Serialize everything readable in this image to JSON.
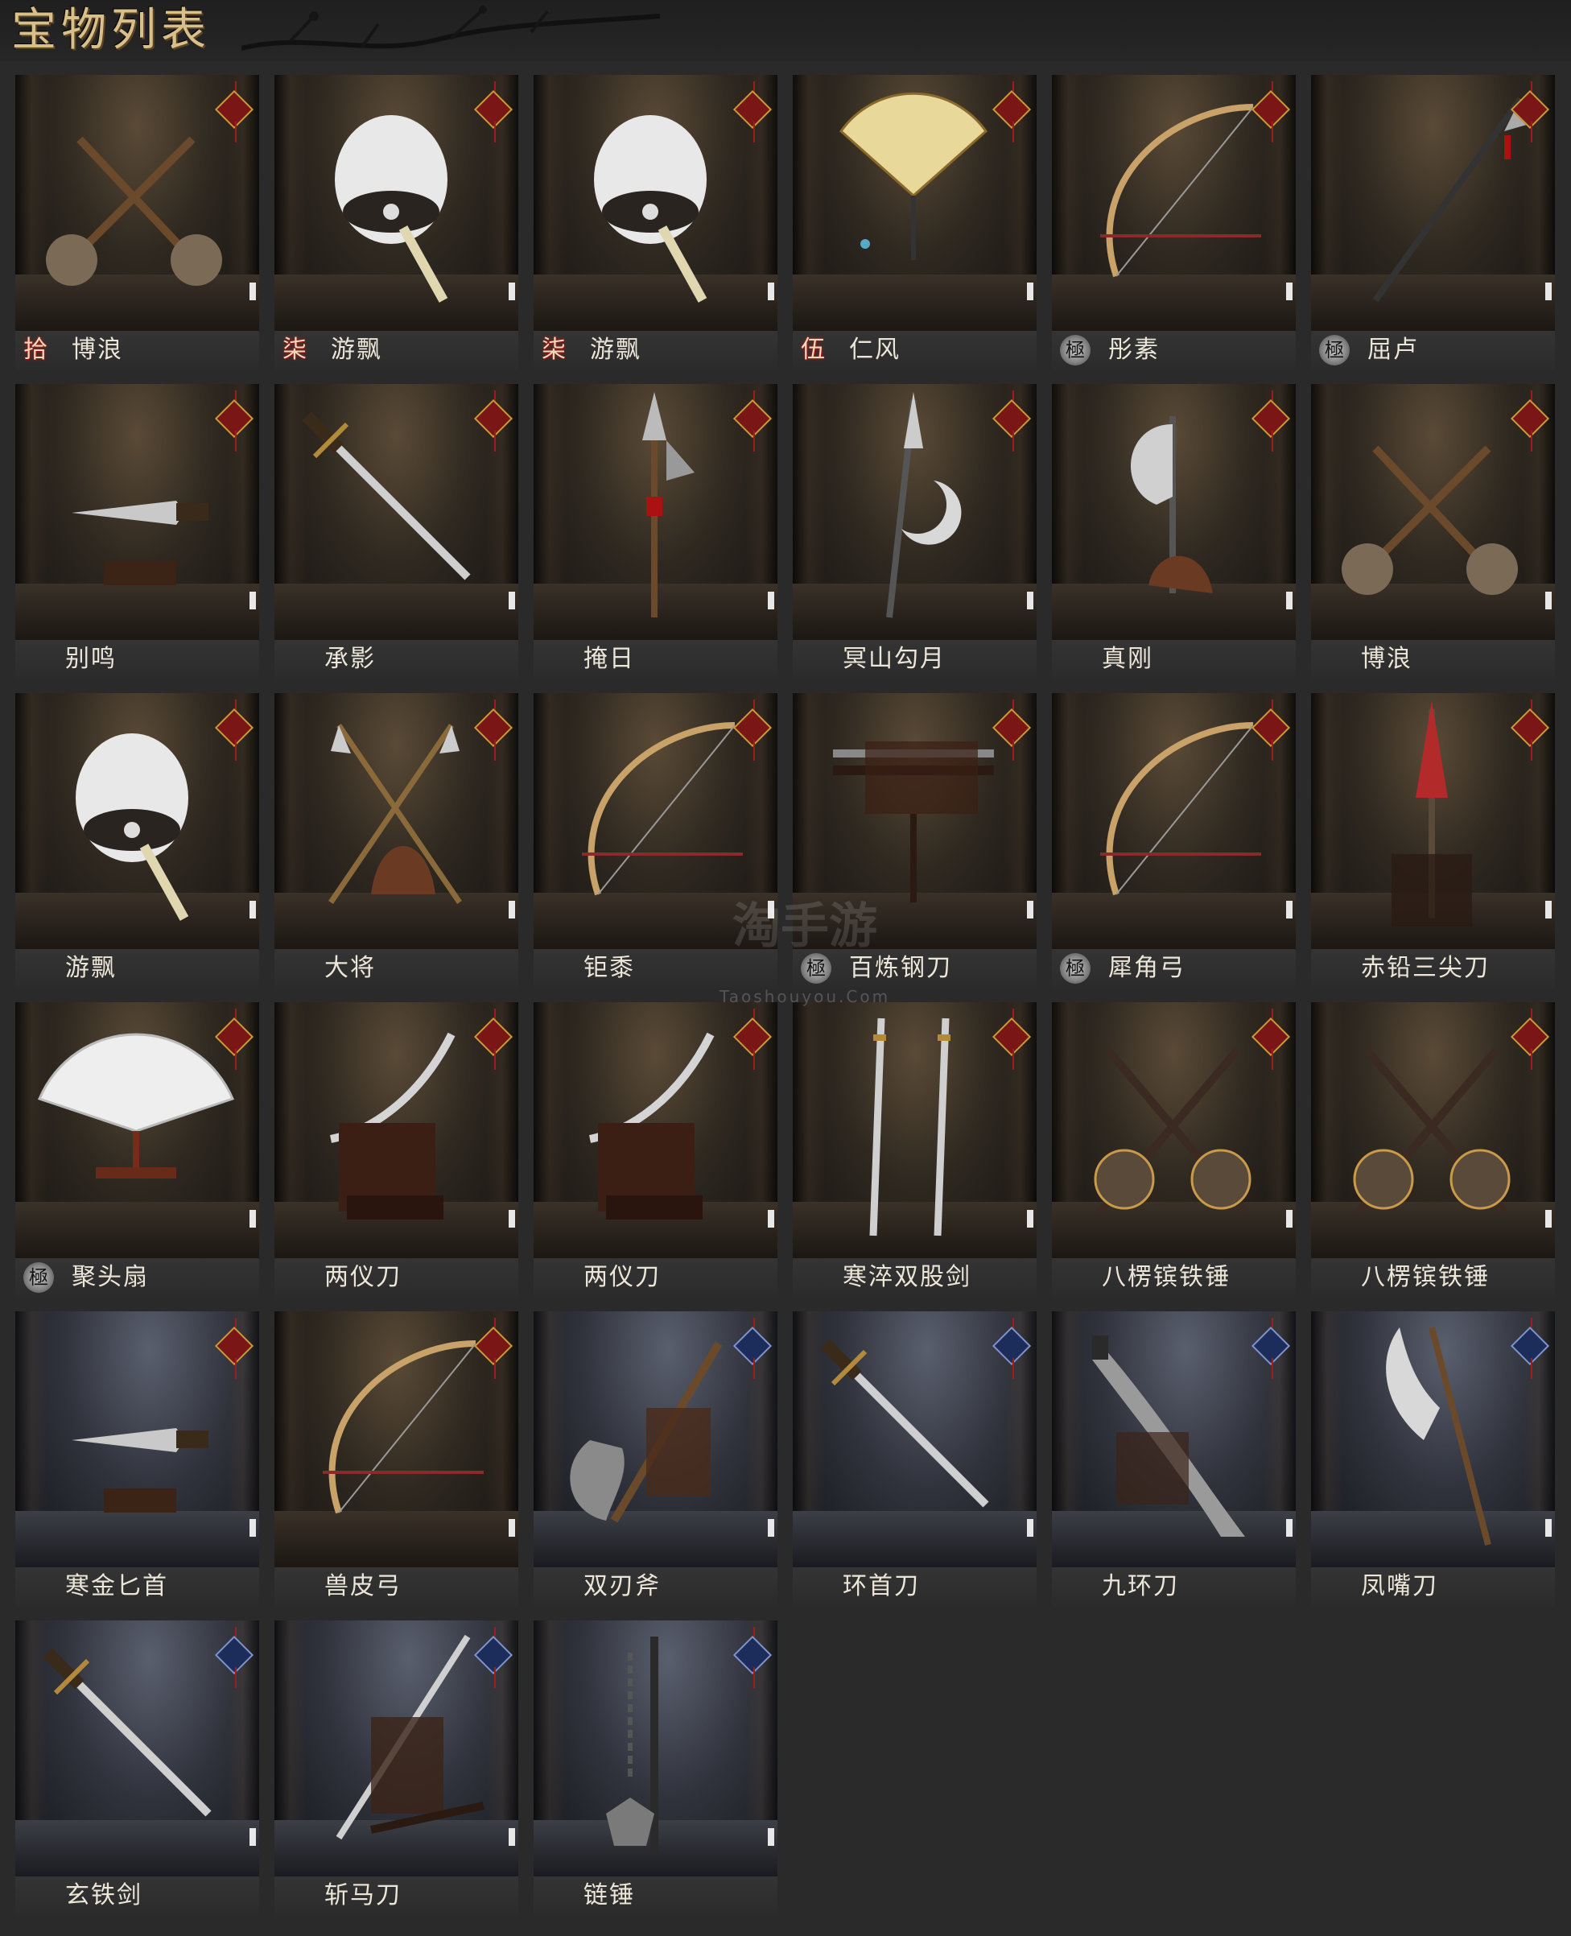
{
  "header": {
    "title": "宝物列表"
  },
  "watermark": {
    "main": "淘手游",
    "sub": "Taoshouyou.Com"
  },
  "colors": {
    "tag_red": "#7a1616",
    "tag_blue": "#1c2d5c",
    "name_text": "#ece6d8",
    "title_gold": "#d9c08a"
  },
  "items": [
    {
      "name": "博浪",
      "rank": "拾",
      "rank_style": "red",
      "weapon": "crossed-hammers",
      "tone": "warm",
      "tag": "red"
    },
    {
      "name": "游飘",
      "rank": "柒",
      "rank_style": "red",
      "weapon": "feather-fan",
      "tone": "warm",
      "tag": "red"
    },
    {
      "name": "游飘",
      "rank": "柒",
      "rank_style": "red",
      "weapon": "feather-fan",
      "tone": "warm",
      "tag": "red"
    },
    {
      "name": "仁风",
      "rank": "伍",
      "rank_style": "red",
      "weapon": "folding-fan",
      "tone": "warm",
      "tag": "red"
    },
    {
      "name": "彤素",
      "rank": "極",
      "rank_style": "gray",
      "weapon": "bow",
      "tone": "warm",
      "tag": "red"
    },
    {
      "name": "屈卢",
      "rank": "極",
      "rank_style": "gray",
      "weapon": "spear",
      "tone": "warm",
      "tag": "red"
    },
    {
      "name": "别鸣",
      "rank": "",
      "rank_style": "",
      "weapon": "dagger",
      "tone": "warm",
      "tag": "red"
    },
    {
      "name": "承影",
      "rank": "",
      "rank_style": "",
      "weapon": "sword",
      "tone": "warm",
      "tag": "red"
    },
    {
      "name": "掩日",
      "rank": "",
      "rank_style": "",
      "weapon": "halberd",
      "tone": "warm",
      "tag": "red"
    },
    {
      "name": "冥山勾月",
      "rank": "",
      "rank_style": "",
      "weapon": "moon-halberd",
      "tone": "warm",
      "tag": "red"
    },
    {
      "name": "真刚",
      "rank": "",
      "rank_style": "",
      "weapon": "axe",
      "tone": "warm",
      "tag": "red"
    },
    {
      "name": "博浪",
      "rank": "",
      "rank_style": "",
      "weapon": "crossed-hammers",
      "tone": "warm",
      "tag": "red"
    },
    {
      "name": "游飘",
      "rank": "",
      "rank_style": "",
      "weapon": "feather-fan",
      "tone": "warm",
      "tag": "red"
    },
    {
      "name": "大将",
      "rank": "",
      "rank_style": "",
      "weapon": "crossed-spears",
      "tone": "warm",
      "tag": "red"
    },
    {
      "name": "钜黍",
      "rank": "",
      "rank_style": "",
      "weapon": "bow",
      "tone": "warm",
      "tag": "red"
    },
    {
      "name": "百炼钢刀",
      "rank": "極",
      "rank_style": "gray",
      "weapon": "sheathed-sword",
      "tone": "warm",
      "tag": "red"
    },
    {
      "name": "犀角弓",
      "rank": "極",
      "rank_style": "gray",
      "weapon": "bow",
      "tone": "warm",
      "tag": "red"
    },
    {
      "name": "赤铅三尖刀",
      "rank": "",
      "rank_style": "",
      "weapon": "red-blade",
      "tone": "warm",
      "tag": "red"
    },
    {
      "name": "聚头扇",
      "rank": "極",
      "rank_style": "gray",
      "weapon": "white-fan",
      "tone": "warm",
      "tag": "red"
    },
    {
      "name": "两仪刀",
      "rank": "",
      "rank_style": "",
      "weapon": "saber-rack",
      "tone": "warm",
      "tag": "red"
    },
    {
      "name": "两仪刀",
      "rank": "",
      "rank_style": "",
      "weapon": "saber-rack",
      "tone": "warm",
      "tag": "red"
    },
    {
      "name": "寒淬双股剑",
      "rank": "",
      "rank_style": "",
      "weapon": "twin-swords",
      "tone": "warm",
      "tag": "red"
    },
    {
      "name": "八楞镔铁锤",
      "rank": "",
      "rank_style": "",
      "weapon": "crossed-maces",
      "tone": "warm",
      "tag": "red"
    },
    {
      "name": "八楞镔铁锤",
      "rank": "",
      "rank_style": "",
      "weapon": "crossed-maces",
      "tone": "warm",
      "tag": "red"
    },
    {
      "name": "寒金匕首",
      "rank": "",
      "rank_style": "",
      "weapon": "dagger",
      "tone": "cool",
      "tag": "red"
    },
    {
      "name": "兽皮弓",
      "rank": "",
      "rank_style": "",
      "weapon": "bow",
      "tone": "warm",
      "tag": "red"
    },
    {
      "name": "双刃斧",
      "rank": "",
      "rank_style": "",
      "weapon": "double-axe",
      "tone": "cool",
      "tag": "blue"
    },
    {
      "name": "环首刀",
      "rank": "",
      "rank_style": "",
      "weapon": "sword",
      "tone": "cool",
      "tag": "blue"
    },
    {
      "name": "九环刀",
      "rank": "",
      "rank_style": "",
      "weapon": "broad-saber",
      "tone": "cool",
      "tag": "blue"
    },
    {
      "name": "凤嘴刀",
      "rank": "",
      "rank_style": "",
      "weapon": "glaive",
      "tone": "cool",
      "tag": "blue"
    },
    {
      "name": "玄铁剑",
      "rank": "",
      "rank_style": "",
      "weapon": "sword",
      "tone": "cool",
      "tag": "blue"
    },
    {
      "name": "斩马刀",
      "rank": "",
      "rank_style": "",
      "weapon": "long-saber",
      "tone": "cool",
      "tag": "blue"
    },
    {
      "name": "链锤",
      "rank": "",
      "rank_style": "",
      "weapon": "chain-hammer",
      "tone": "cool",
      "tag": "blue"
    }
  ]
}
